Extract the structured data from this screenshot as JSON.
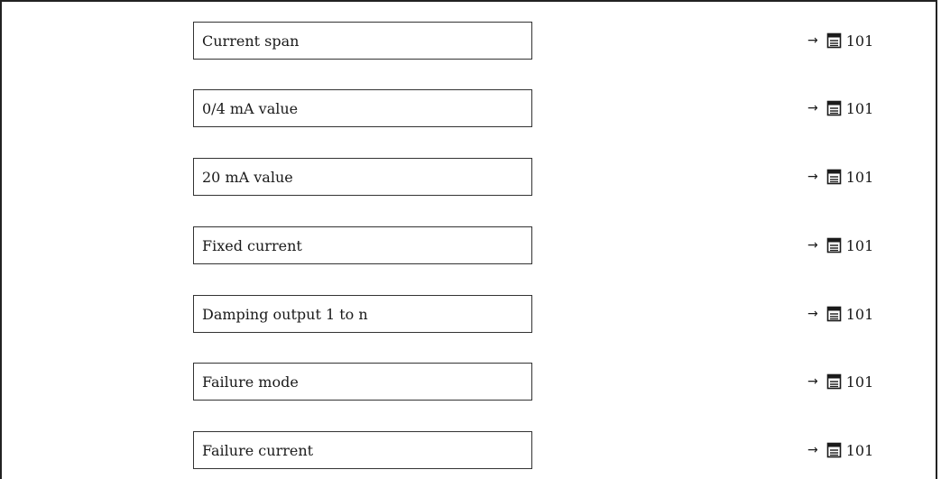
{
  "parameters": [
    {
      "label": "Current span",
      "ref_page": "101"
    },
    {
      "label": "0/4 mA value",
      "ref_page": "101"
    },
    {
      "label": "20 mA value",
      "ref_page": "101"
    },
    {
      "label": "Fixed current",
      "ref_page": "101"
    },
    {
      "label": "Damping output 1 to n",
      "ref_page": "101"
    },
    {
      "label": "Failure mode",
      "ref_page": "101"
    },
    {
      "label": "Failure current",
      "ref_page": "101"
    }
  ],
  "ref_arrow": "→",
  "ref_icon": "page-reference-icon"
}
